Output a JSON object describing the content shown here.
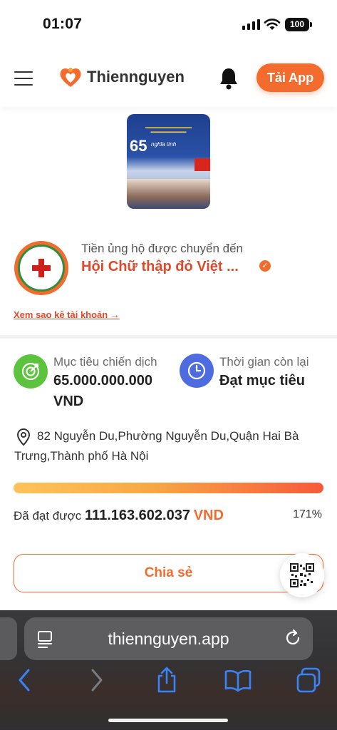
{
  "status": {
    "time": "01:07",
    "battery": "100"
  },
  "header": {
    "logo_text": "Thiennguyen",
    "cta_label": "Tải App"
  },
  "organization": {
    "label": "Tiền ủng hộ được chuyển đến",
    "name": "Hội Chữ thập đỏ Việt ...",
    "statement_link": "Xem sao kê tài khoản →"
  },
  "banner": {
    "number": "65",
    "subtitle": "nghĩa tình"
  },
  "stats": {
    "goal_label": "Mục tiêu chiến dịch",
    "goal_value": "65.000.000.000",
    "goal_unit": "VND",
    "time_label": "Thời gian còn lại",
    "time_value": "Đạt mục tiêu"
  },
  "address": "82 Nguyễn Du,Phường Nguyễn Du,Quận Hai Bà Trưng,Thành phố Hà Nội",
  "progress": {
    "fraction": 1.0,
    "achieved_label": "Đã đạt được",
    "achieved_value": "111.163.602.037",
    "achieved_unit": "VND",
    "percent_text": "171%"
  },
  "share_label": "Chia sẻ",
  "browser": {
    "url": "thiennguyen.app"
  },
  "icons": {
    "menu": "hamburger-icon",
    "bell": "bell-icon",
    "goal": "target-icon",
    "time": "clock-icon",
    "pin": "location-pin-icon",
    "qr": "qr-code-icon",
    "reader": "reader-icon",
    "reload": "reload-icon",
    "back": "back-arrow-icon",
    "forward": "forward-arrow-icon",
    "share": "share-icon",
    "bookmarks": "book-icon",
    "tabs": "tabs-icon"
  },
  "colors": {
    "accent": "#f36c2d",
    "org_name": "#e2492c",
    "goal_icon": "#5cc33c",
    "time_icon": "#4e6be0",
    "browser_icon": "#3a82f7"
  }
}
